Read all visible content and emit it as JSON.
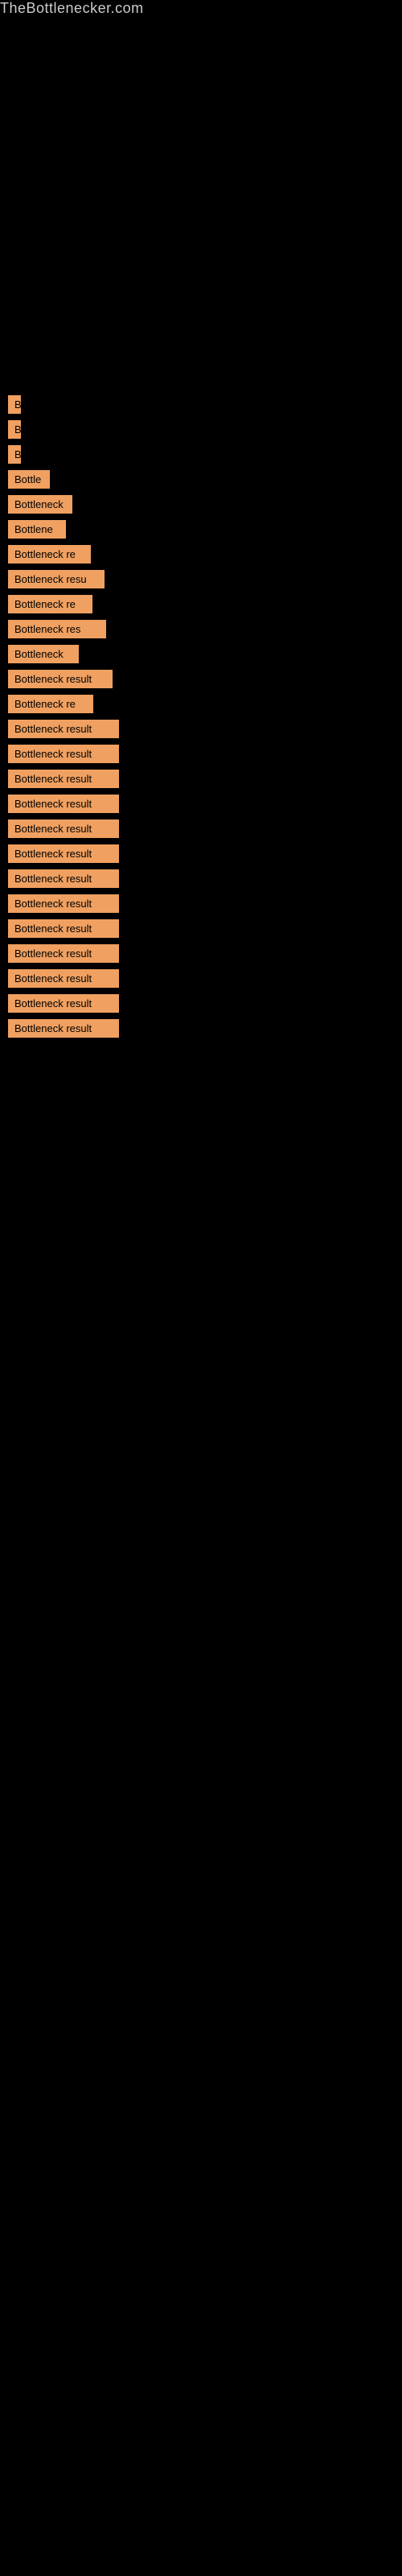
{
  "site": {
    "title": "TheBottlenecker.com"
  },
  "items": [
    {
      "id": 1,
      "label": "B",
      "class": "item-1"
    },
    {
      "id": 2,
      "label": "B",
      "class": "item-2"
    },
    {
      "id": 3,
      "label": "B",
      "class": "item-3"
    },
    {
      "id": 4,
      "label": "Bottle",
      "class": "item-4"
    },
    {
      "id": 5,
      "label": "Bottleneck",
      "class": "item-5"
    },
    {
      "id": 6,
      "label": "Bottlene",
      "class": "item-6"
    },
    {
      "id": 7,
      "label": "Bottleneck re",
      "class": "item-7"
    },
    {
      "id": 8,
      "label": "Bottleneck resu",
      "class": "item-8"
    },
    {
      "id": 9,
      "label": "Bottleneck re",
      "class": "item-9"
    },
    {
      "id": 10,
      "label": "Bottleneck res",
      "class": "item-10"
    },
    {
      "id": 11,
      "label": "Bottleneck",
      "class": "item-11"
    },
    {
      "id": 12,
      "label": "Bottleneck result",
      "class": "item-12"
    },
    {
      "id": 13,
      "label": "Bottleneck re",
      "class": "item-13"
    },
    {
      "id": 14,
      "label": "Bottleneck result",
      "class": "item-14"
    },
    {
      "id": 15,
      "label": "Bottleneck result",
      "class": "item-15"
    },
    {
      "id": 16,
      "label": "Bottleneck result",
      "class": "item-16"
    },
    {
      "id": 17,
      "label": "Bottleneck result",
      "class": "item-17"
    },
    {
      "id": 18,
      "label": "Bottleneck result",
      "class": "item-18"
    },
    {
      "id": 19,
      "label": "Bottleneck result",
      "class": "item-19"
    },
    {
      "id": 20,
      "label": "Bottleneck result",
      "class": "item-20"
    },
    {
      "id": 21,
      "label": "Bottleneck result",
      "class": "item-21"
    },
    {
      "id": 22,
      "label": "Bottleneck result",
      "class": "item-22"
    },
    {
      "id": 23,
      "label": "Bottleneck result",
      "class": "item-23"
    },
    {
      "id": 24,
      "label": "Bottleneck result",
      "class": "item-24"
    },
    {
      "id": 25,
      "label": "Bottleneck result",
      "class": "item-25"
    },
    {
      "id": 26,
      "label": "Bottleneck result",
      "class": "item-26"
    }
  ]
}
